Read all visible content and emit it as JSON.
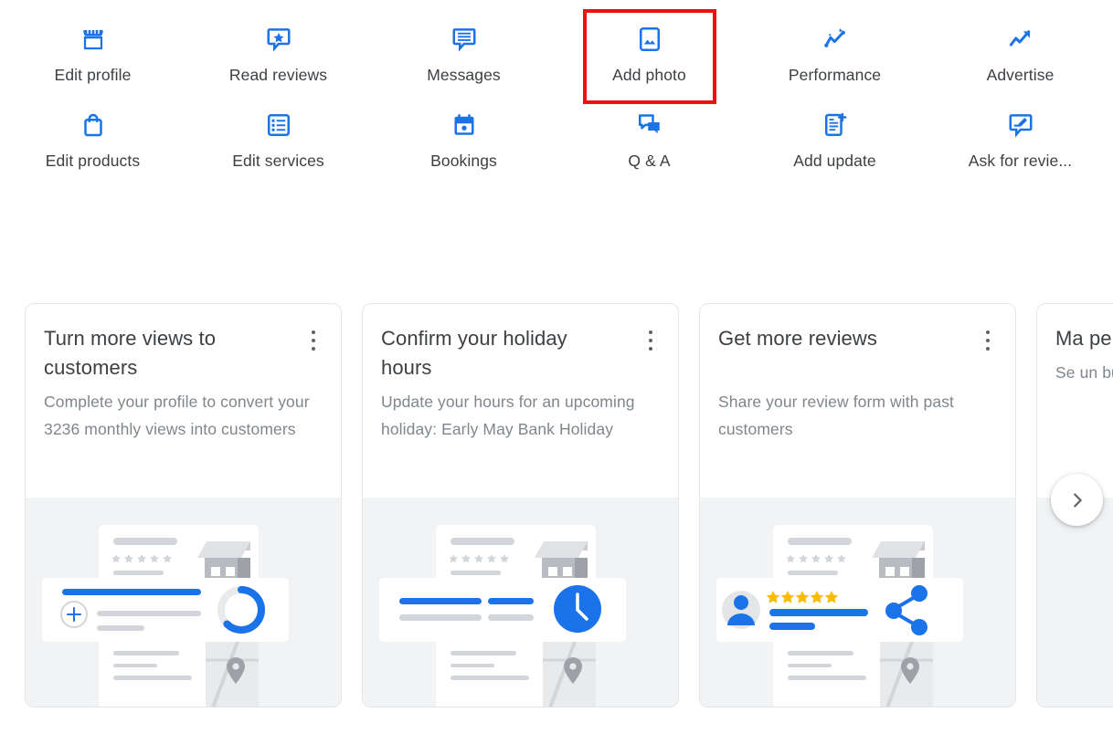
{
  "quick_actions": {
    "items": [
      {
        "label": "Edit profile",
        "icon": "storefront-icon",
        "highlighted": false
      },
      {
        "label": "Read reviews",
        "icon": "review-star-bubble-icon",
        "highlighted": false
      },
      {
        "label": "Messages",
        "icon": "message-lines-icon",
        "highlighted": false
      },
      {
        "label": "Add photo",
        "icon": "add-photo-icon",
        "highlighted": true
      },
      {
        "label": "Performance",
        "icon": "performance-sparkline-icon",
        "highlighted": false
      },
      {
        "label": "Advertise",
        "icon": "trending-up-arrow-icon",
        "highlighted": false
      },
      {
        "label": "Edit products",
        "icon": "shopping-bag-icon",
        "highlighted": false
      },
      {
        "label": "Edit services",
        "icon": "services-list-icon",
        "highlighted": false
      },
      {
        "label": "Bookings",
        "icon": "calendar-icon",
        "highlighted": false
      },
      {
        "label": "Q & A",
        "icon": "qa-bubbles-icon",
        "highlighted": false
      },
      {
        "label": "Add update",
        "icon": "add-post-icon",
        "highlighted": false
      },
      {
        "label": "Ask for revie...",
        "icon": "ask-review-bubble-icon",
        "highlighted": false
      }
    ]
  },
  "carousel": {
    "next_label": "›",
    "cards": [
      {
        "title": "Turn more views to customers",
        "description": "Complete your profile to convert your 3236 monthly views into customers",
        "menu_label": "⋮",
        "art": "progress-ring-illustration"
      },
      {
        "title": "Confirm your holiday hours",
        "description": "Update your hours for an upcoming holiday: Early May Bank Holiday",
        "menu_label": "⋮",
        "art": "clock-illustration"
      },
      {
        "title": "Get more reviews",
        "description": "Share your review form with past customers",
        "menu_label": "⋮",
        "art": "review-share-illustration"
      },
      {
        "title": "Mа pe",
        "description": "Se un bu",
        "menu_label": "⋮",
        "art": "cut-off-illustration"
      }
    ]
  },
  "colors": {
    "accent_blue": "#1a73e8",
    "icon_blue": "#1a73e8",
    "text_primary": "#3c4043",
    "text_secondary": "#80868b",
    "highlight_red": "#ee1111",
    "card_art_bg": "#f1f3f4",
    "star_gold": "#fbbc04"
  }
}
